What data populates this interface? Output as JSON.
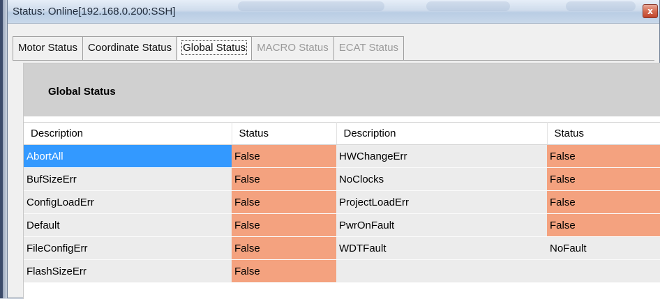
{
  "window": {
    "title": "Status: Online[192.168.0.200:SSH]",
    "close_glyph": "x"
  },
  "tabs": [
    {
      "label": "Motor Status",
      "state": "normal"
    },
    {
      "label": "Coordinate Status",
      "state": "normal"
    },
    {
      "label": "Global Status",
      "state": "active"
    },
    {
      "label": "MACRO Status",
      "state": "disabled"
    },
    {
      "label": "ECAT Status",
      "state": "disabled"
    }
  ],
  "panel": {
    "title": "Global Status"
  },
  "table": {
    "headers": [
      "Description",
      "Status",
      "Description",
      "Status"
    ],
    "rows": [
      {
        "desc1": "AbortAll",
        "status1": "False",
        "desc2": "HWChangeErr",
        "status2": "False"
      },
      {
        "desc1": "BufSizeErr",
        "status1": "False",
        "desc2": "NoClocks",
        "status2": "False"
      },
      {
        "desc1": "ConfigLoadErr",
        "status1": "False",
        "desc2": "ProjectLoadErr",
        "status2": "False"
      },
      {
        "desc1": "Default",
        "status1": "False",
        "desc2": "PwrOnFault",
        "status2": "False"
      },
      {
        "desc1": "FileConfigErr",
        "status1": "False",
        "desc2": "WDTFault",
        "status2": "NoFault"
      },
      {
        "desc1": "FlashSizeErr",
        "status1": "False",
        "desc2": "",
        "status2": ""
      }
    ]
  },
  "colors": {
    "selected_row": "#3399ff",
    "false_status": "#f4a27f",
    "header_band": "#d0d0d0"
  },
  "icons": {
    "close": "close-icon"
  }
}
